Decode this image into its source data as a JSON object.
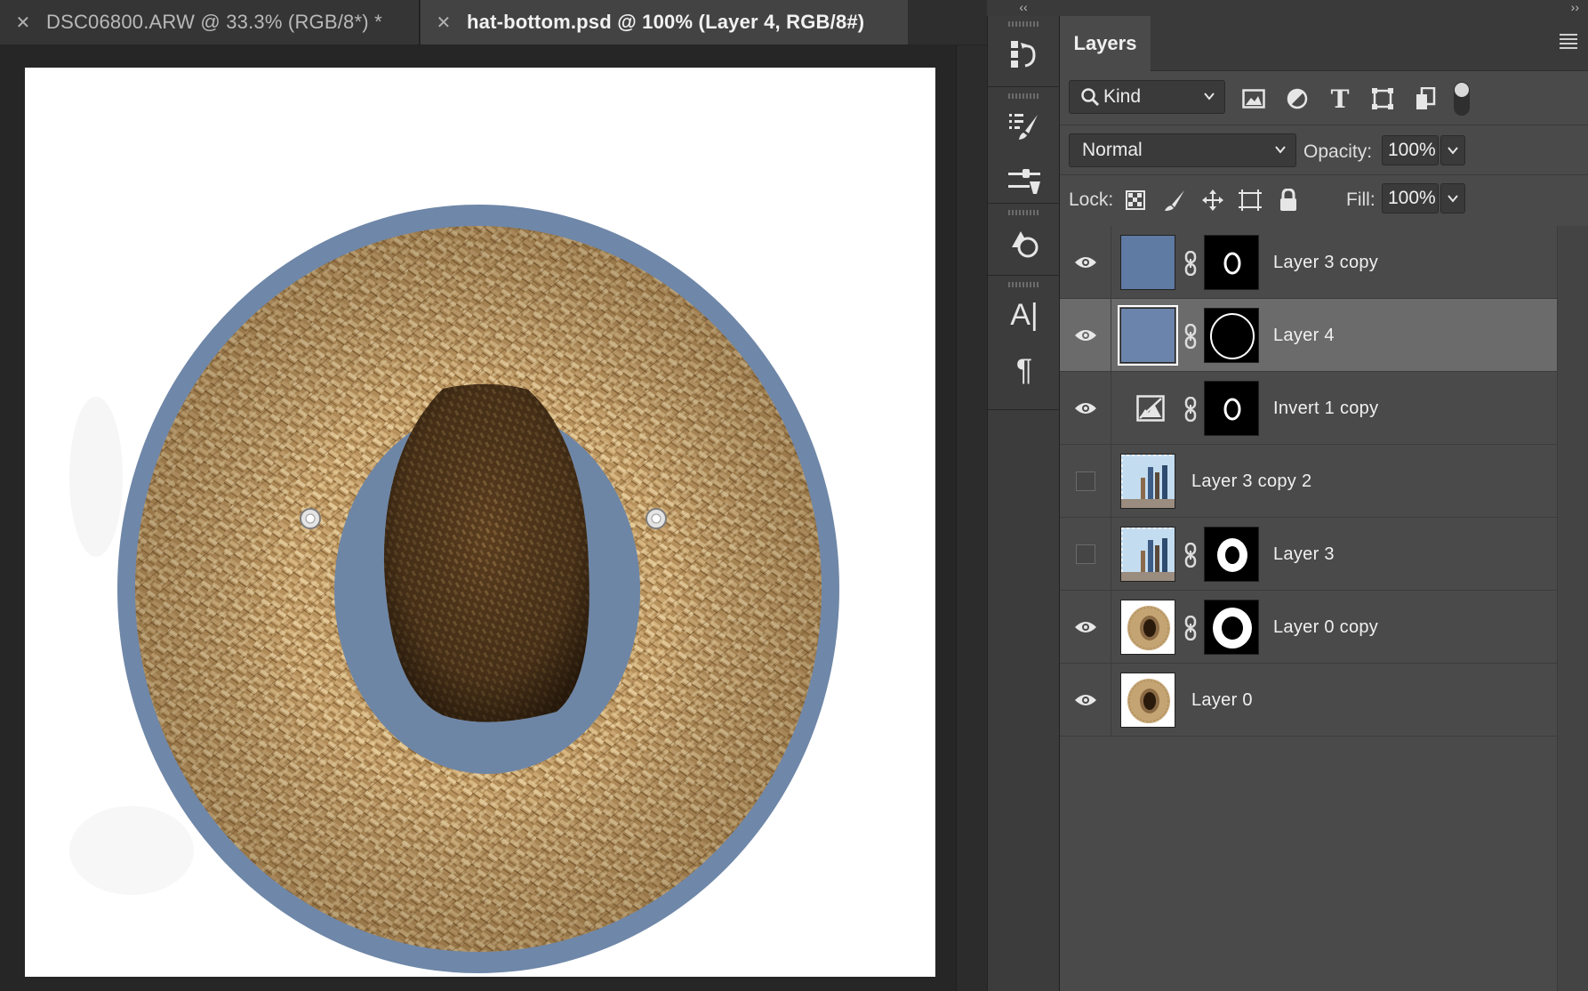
{
  "tabs": [
    {
      "label": "DSC06800.ARW @ 33.3% (RGB/8*) *",
      "active": false
    },
    {
      "label": "hat-bottom.psd @ 100% (Layer 4, RGB/8#)",
      "active": true
    }
  ],
  "tool_strip": {
    "icons": [
      "history-icon",
      "brush-settings-icon",
      "adjust-sliders-icon",
      "shapes-icon",
      "character-icon",
      "paragraph-icon"
    ],
    "character_glyph": "A|",
    "paragraph_glyph": "¶"
  },
  "panel": {
    "title": "Layers",
    "filter": {
      "kind_label": "Kind",
      "icons": [
        "image-filter-icon",
        "adjustment-filter-icon",
        "type-filter-icon",
        "shape-filter-icon",
        "smart-object-filter-icon"
      ],
      "type_glyph": "T"
    },
    "blend_mode": "Normal",
    "opacity_label": "Opacity:",
    "opacity_value": "100%",
    "lock_label": "Lock:",
    "fill_label": "Fill:",
    "fill_value": "100%",
    "layers": [
      {
        "name": "Layer 3 copy",
        "visible": true,
        "selected": false,
        "thumb": "blue",
        "mask": "ring-small"
      },
      {
        "name": "Layer 4",
        "visible": true,
        "selected": true,
        "thumb": "blue",
        "mask": "oval-outline"
      },
      {
        "name": "Invert 1 copy",
        "visible": true,
        "selected": false,
        "thumb": "adjustment",
        "mask": "ring-small"
      },
      {
        "name": "Layer 3 copy 2",
        "visible": false,
        "selected": false,
        "thumb": "photo",
        "mask": null
      },
      {
        "name": "Layer 3",
        "visible": false,
        "selected": false,
        "thumb": "photo",
        "mask": "ring-white"
      },
      {
        "name": "Layer 0 copy",
        "visible": true,
        "selected": false,
        "thumb": "hat",
        "mask": "ring-white-thick"
      },
      {
        "name": "Layer 0",
        "visible": true,
        "selected": false,
        "thumb": "hat",
        "mask": null
      }
    ]
  },
  "colors": {
    "brim_blue": "#6f87a8",
    "band_blue": "#6e86a6",
    "straw_light": "#c9a877",
    "straw_dark": "#7a5a33",
    "thumb_blue": "#5f7aa3"
  }
}
